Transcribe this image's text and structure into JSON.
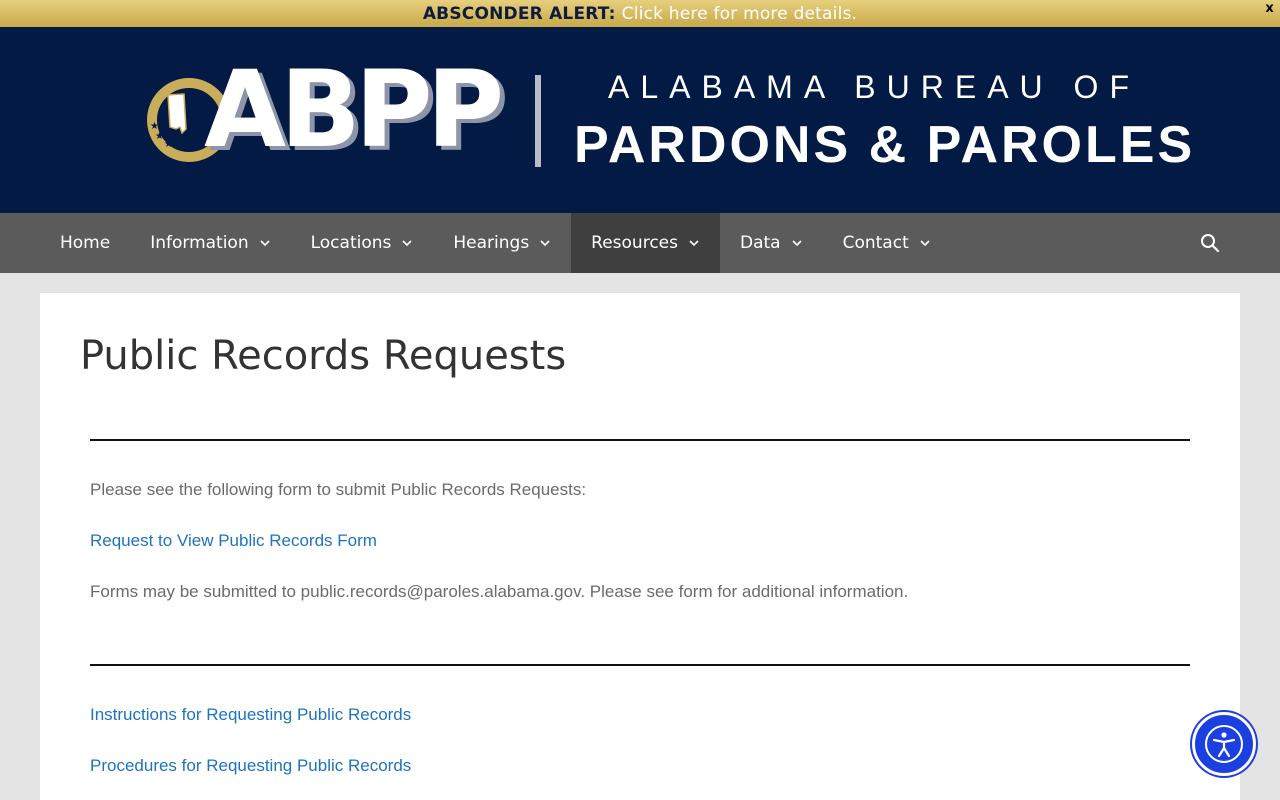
{
  "alert": {
    "label": "ABSCONDER ALERT:",
    "link_text": "Click here for more details.",
    "close_label": "x"
  },
  "header": {
    "logo_abbr": "ABPP",
    "logo_line1": "ALABAMA BUREAU OF",
    "logo_line2": "PARDONS & PAROLES"
  },
  "nav": {
    "items": [
      {
        "label": "Home",
        "has_dropdown": false
      },
      {
        "label": "Information",
        "has_dropdown": true
      },
      {
        "label": "Locations",
        "has_dropdown": true
      },
      {
        "label": "Hearings",
        "has_dropdown": true
      },
      {
        "label": "Resources",
        "has_dropdown": true,
        "active": true
      },
      {
        "label": "Data",
        "has_dropdown": true
      },
      {
        "label": "Contact",
        "has_dropdown": true
      }
    ],
    "search_icon": "search-icon"
  },
  "main": {
    "title": "Public Records Requests",
    "intro": "Please see the following form to submit Public Records Requests:",
    "form_link": "Request to View Public Records Form",
    "note": "Forms may be submitted to public.records@paroles.alabama.gov. Please see form for additional information.",
    "instructions_link": "Instructions for Requesting Public Records",
    "procedures_link": "Procedures for Requesting Public Records"
  },
  "accessibility": {
    "icon": "accessibility-icon"
  },
  "colors": {
    "alert_gold": "#d4b961",
    "header_navy": "#031a45",
    "nav_gray": "#5b5b5b",
    "nav_active": "#3f3f3f",
    "link_blue": "#1e73be",
    "a11y_blue": "#1b3fe0"
  }
}
